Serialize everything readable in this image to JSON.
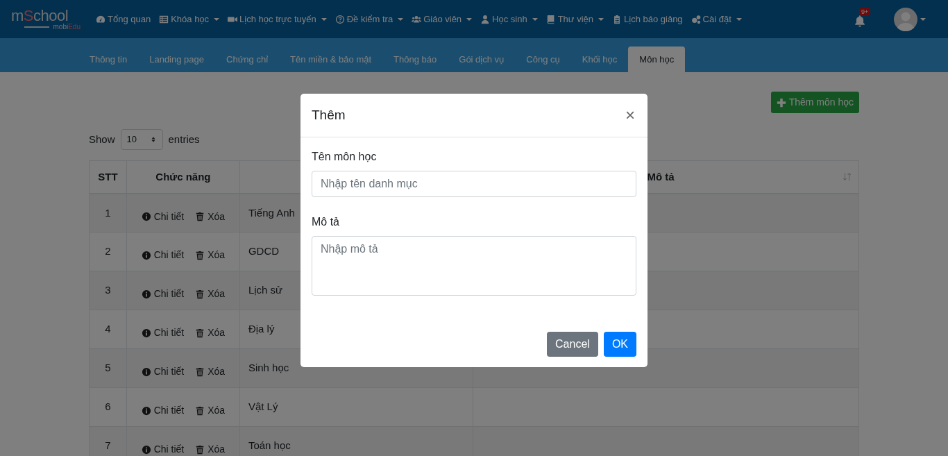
{
  "logo": {
    "main": [
      {
        "text": "m",
        "accent": false
      },
      {
        "text": "S",
        "accent": true
      },
      {
        "text": "chool",
        "accent": false
      }
    ],
    "sub": [
      {
        "text": "mobi",
        "accent": false
      },
      {
        "text": "Edu",
        "accent": true
      }
    ]
  },
  "nav": [
    {
      "label": "Tổng quan",
      "kind": "gauge",
      "dropdown": false
    },
    {
      "label": "Khóa học",
      "kind": "list",
      "dropdown": true
    },
    {
      "label": "Lịch học trực tuyến",
      "kind": "video",
      "dropdown": true
    },
    {
      "label": "Đề kiểm tra",
      "kind": "question",
      "dropdown": true
    },
    {
      "label": "Giáo viên",
      "kind": "users",
      "dropdown": true
    },
    {
      "label": "Học sinh",
      "kind": "user",
      "dropdown": true
    },
    {
      "label": "Thư viện",
      "kind": "book",
      "dropdown": true
    },
    {
      "label": "Lịch báo giảng",
      "kind": "clipboard",
      "dropdown": false
    },
    {
      "label": "Cài đặt",
      "kind": "cogs",
      "dropdown": true
    }
  ],
  "notifications": {
    "badge": "9+"
  },
  "tabs": [
    {
      "label": "Thông tin",
      "selected": false
    },
    {
      "label": "Landing page",
      "selected": false
    },
    {
      "label": "Chứng chỉ",
      "selected": false
    },
    {
      "label": "Tên miền & bảo mật",
      "selected": false
    },
    {
      "label": "Thông báo",
      "selected": false
    },
    {
      "label": "Gói dịch vụ",
      "selected": false
    },
    {
      "label": "Công cụ",
      "selected": false
    },
    {
      "label": "Khối học",
      "selected": false
    },
    {
      "label": "Môn học",
      "selected": true
    }
  ],
  "add_button": {
    "label": "Thêm môn học"
  },
  "length_menu": {
    "before": "Show",
    "value": "10",
    "after": "entries"
  },
  "table": {
    "columns": [
      {
        "label": "STT",
        "sortable": false
      },
      {
        "label": "Chức năng",
        "sortable": false
      },
      {},
      {
        "label": "Mô tả",
        "sortable": true
      }
    ],
    "rows": [
      {
        "stt": "1",
        "actions": [
          {
            "kind": "detail",
            "label": "Chi tiết"
          },
          {
            "kind": "delete",
            "label": "Xóa"
          }
        ],
        "name": "Tiếng Anh"
      },
      {
        "stt": "2",
        "actions": [
          {
            "kind": "detail",
            "label": "Chi tiết"
          },
          {
            "kind": "delete",
            "label": "Xóa"
          }
        ],
        "name": "GDCD"
      },
      {
        "stt": "3",
        "actions": [
          {
            "kind": "detail",
            "label": "Chi tiết"
          },
          {
            "kind": "delete",
            "label": "Xóa"
          }
        ],
        "name": "Lịch sử"
      },
      {
        "stt": "4",
        "actions": [
          {
            "kind": "detail",
            "label": "Chi tiết"
          },
          {
            "kind": "delete",
            "label": "Xóa"
          }
        ],
        "name": "Địa lý"
      },
      {
        "stt": "5",
        "actions": [
          {
            "kind": "detail",
            "label": "Chi tiết"
          },
          {
            "kind": "delete",
            "label": "Xóa"
          }
        ],
        "name": "Sinh học"
      },
      {
        "stt": "6",
        "actions": [
          {
            "kind": "detail",
            "label": "Chi tiết"
          },
          {
            "kind": "delete",
            "label": "Xóa"
          }
        ],
        "name": "Vật Lý"
      },
      {
        "stt": "7",
        "actions": [
          {
            "kind": "detail",
            "label": "Chi tiết"
          },
          {
            "kind": "delete",
            "label": "Xóa"
          }
        ],
        "name": "Toán học"
      }
    ]
  },
  "modal": {
    "title": "Thêm",
    "close": "×",
    "fields": [
      {
        "kind": "input",
        "label": "Tên môn học",
        "placeholder": "Nhập tên danh mục"
      },
      {
        "kind": "textarea",
        "label": "Mô tả",
        "placeholder": "Nhập mô tả"
      }
    ],
    "buttons": [
      {
        "kind": "secondary",
        "label": "Cancel"
      },
      {
        "kind": "primary",
        "label": "OK"
      }
    ]
  }
}
